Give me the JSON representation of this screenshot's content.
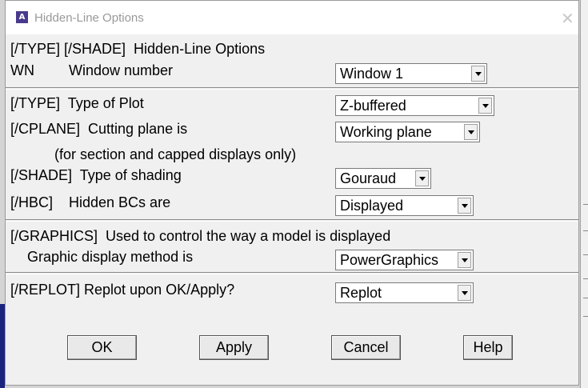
{
  "window": {
    "title": "Hidden-Line Options",
    "icon_letter": "A"
  },
  "sections": {
    "header": {
      "heading": "[/TYPE] [/SHADE]  Hidden-Line Options",
      "wn_code": "WN",
      "wn_label": "Window number",
      "window_value": "Window 1"
    },
    "type": {
      "type_label": "[/TYPE]  Type of Plot",
      "type_value": "Z-buffered",
      "cplane_label": "[/CPLANE]  Cutting plane is",
      "cplane_value": "Working plane",
      "cplane_note": "(for section and capped displays only)",
      "shade_label": "[/SHADE]  Type of shading",
      "shade_value": "Gouraud",
      "hbc_label": "[/HBC]    Hidden BCs are",
      "hbc_value": "Displayed"
    },
    "graphics": {
      "heading": "[/GRAPHICS]  Used to control the way a model is displayed",
      "method_label": "Graphic display method is",
      "method_value": "PowerGraphics"
    },
    "replot": {
      "label": "[/REPLOT] Replot upon OK/Apply?",
      "value": "Replot"
    }
  },
  "buttons": {
    "ok": "OK",
    "apply": "Apply",
    "cancel": "Cancel",
    "help": "Help"
  }
}
